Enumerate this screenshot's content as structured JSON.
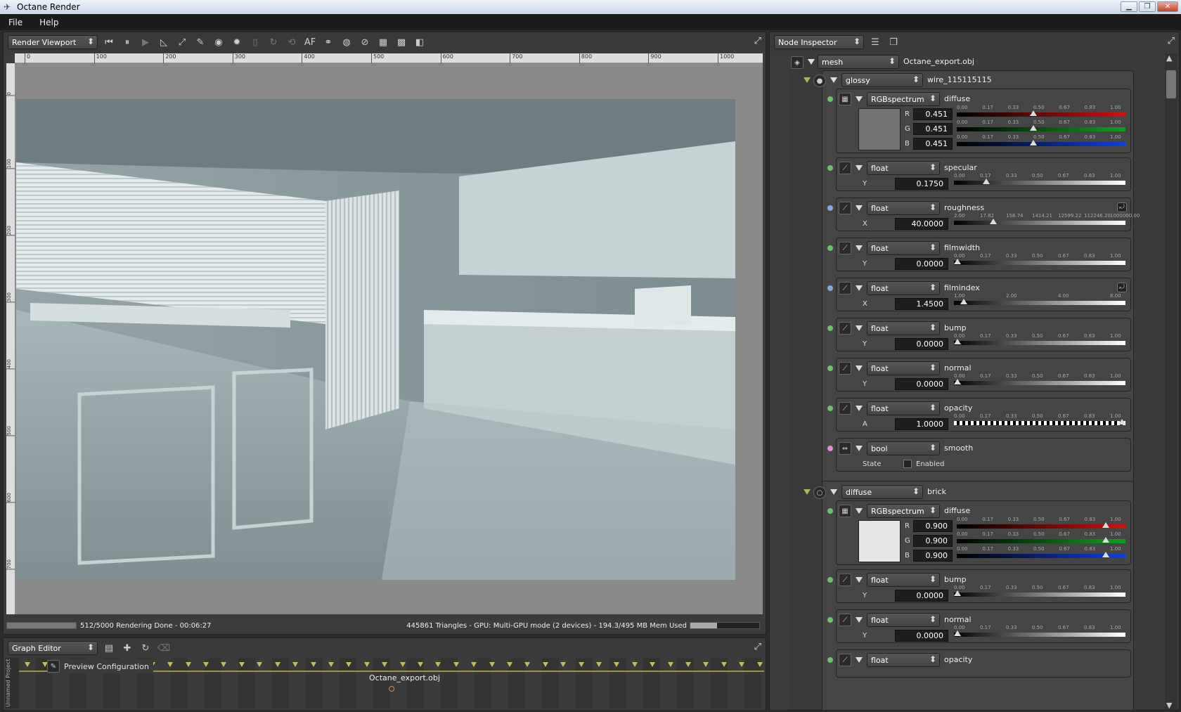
{
  "window": {
    "title": "Octane Render"
  },
  "menu": [
    "File",
    "Help"
  ],
  "viewport": {
    "mode": "Render Viewport",
    "af_label": "AF",
    "ruler_h": [
      "0",
      "100",
      "200",
      "300",
      "400",
      "500",
      "600",
      "700",
      "800",
      "900",
      "1000"
    ],
    "ruler_v": [
      "0",
      "100",
      "200",
      "300",
      "400",
      "500",
      "600",
      "700"
    ],
    "status_left": "512/5000 Rendering Done - 00:06:27",
    "status_right": "445861 Triangles - GPU: Multi-GPU mode (2 devices) - 194.3/495 MB Mem Used",
    "render_progress": 1.0,
    "mem_fraction": 0.39
  },
  "graph": {
    "mode": "Graph Editor",
    "side_label": "Unnamed Project",
    "preview_config": "Preview Configuration",
    "node": "Octane_export.obj"
  },
  "inspector": {
    "mode": "Node Inspector",
    "mesh": {
      "type": "mesh",
      "name": "Octane_export.obj"
    },
    "mat1": {
      "type": "glossy",
      "name": "wire_115115115"
    },
    "mat2": {
      "type": "diffuse",
      "name": "brick"
    },
    "std_ticks": [
      "0.00",
      "0.17",
      "0.33",
      "0.50",
      "0.67",
      "0.83",
      "1.00"
    ],
    "rough_ticks": [
      "2.00",
      "17.82",
      "158.74",
      "1414.21",
      "12599.22",
      "112246.20",
      "1000000.00"
    ],
    "index_ticks": [
      "1.00",
      "2.00",
      "4.00",
      "8.00"
    ],
    "diffuse1": {
      "type": "RGBspectrum",
      "pin": "diffuse",
      "r": "0.451",
      "g": "0.451",
      "b": "0.451",
      "swatch": "#737373"
    },
    "specular": {
      "type": "float",
      "pin": "specular",
      "ch": "Y",
      "value": "0.1750",
      "frac": 0.175
    },
    "roughness": {
      "type": "float",
      "pin": "roughness",
      "ch": "X",
      "value": "40.0000",
      "frac": 0.22
    },
    "filmwidth": {
      "type": "float",
      "pin": "filmwidth",
      "ch": "Y",
      "value": "0.0000",
      "frac": 0.0
    },
    "filmindex": {
      "type": "float",
      "pin": "filmindex",
      "ch": "X",
      "value": "1.4500",
      "frac": 0.04
    },
    "bump1": {
      "type": "float",
      "pin": "bump",
      "ch": "Y",
      "value": "0.0000",
      "frac": 0.0
    },
    "normal1": {
      "type": "float",
      "pin": "normal",
      "ch": "Y",
      "value": "0.0000",
      "frac": 0.0
    },
    "opacity1": {
      "type": "float",
      "pin": "opacity",
      "ch": "A",
      "value": "1.0000",
      "frac": 1.0
    },
    "smooth": {
      "type": "bool",
      "pin": "smooth",
      "ch": "State",
      "value": "Enabled"
    },
    "diffuse2": {
      "type": "RGBspectrum",
      "pin": "diffuse",
      "r": "0.900",
      "g": "0.900",
      "b": "0.900",
      "swatch": "#e6e6e6"
    },
    "bump2": {
      "type": "float",
      "pin": "bump",
      "ch": "Y",
      "value": "0.0000",
      "frac": 0.0
    },
    "normal2": {
      "type": "float",
      "pin": "normal",
      "ch": "Y",
      "value": "0.0000",
      "frac": 0.0
    },
    "opacity2": {
      "type": "float",
      "pin": "opacity"
    }
  },
  "colors": {
    "red": "#d01010",
    "green": "#10a020",
    "blue": "#1040e0",
    "pin_green": "#6fc06f",
    "pin_blue": "#8aa8e0",
    "pin_pink": "#d98fd9"
  }
}
